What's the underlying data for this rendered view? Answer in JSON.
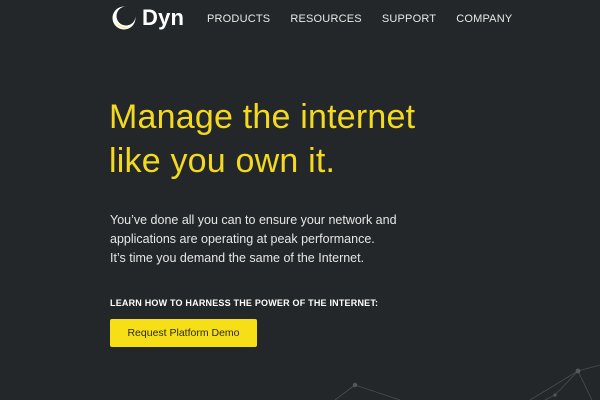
{
  "header": {
    "logo_text": "Dyn",
    "nav": [
      "PRODUCTS",
      "RESOURCES",
      "SUPPORT",
      "COMPANY"
    ]
  },
  "hero": {
    "title_lines": [
      "Manage the internet",
      "like you own it."
    ],
    "body_lines": [
      "You’ve done all you can to ensure your network and",
      "applications are operating at peak performance.",
      "It’s time you demand the same of the Internet."
    ],
    "cta_heading": "LEARN HOW TO HARNESS THE POWER OF THE INTERNET:",
    "cta_button": "Request Platform Demo"
  },
  "colors": {
    "background": "#242729",
    "accent_yellow": "#f3da1f",
    "button_yellow": "#f6df16",
    "text_white": "#ffffff"
  },
  "icons": {
    "logo": "dyn-crescent-logo-icon",
    "decoration": "network-nodes-decoration"
  }
}
